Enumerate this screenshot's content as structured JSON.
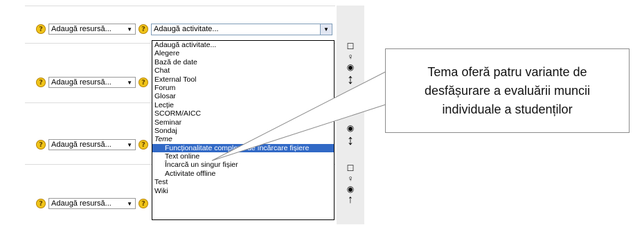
{
  "rows": [
    {
      "resource_label": "Adaugă resursă...",
      "activity_label": "Adaugă activitate..."
    },
    {
      "resource_label": "Adaugă resursă..."
    },
    {
      "resource_label": "Adaugă resursă..."
    },
    {
      "resource_label": "Adaugă resursă..."
    }
  ],
  "dropdown": {
    "options": [
      "Adaugă activitate...",
      "Alegere",
      "Bază de date",
      "Chat",
      "External Tool",
      "Forum",
      "Glosar",
      "Lecție",
      "SCORM/AICC",
      "Seminar",
      "Sondaj"
    ],
    "group_label": "Teme",
    "group_options": [
      "Funcționalitate complexă de încărcare fișiere",
      "Text online",
      "Încarcă un singur fișier",
      "Activitate offline"
    ],
    "trailing_options": [
      "Test",
      "Wiki"
    ],
    "selected": "Funcționalitate complexă de încărcare fișiere"
  },
  "callout": {
    "text": "Tema oferă patru variante de desfășurare a evaluării muncii individuale a studenților"
  },
  "colors": {
    "highlight": "#3169c6",
    "help_icon": "#f0c419"
  },
  "icons": [
    "help-icon",
    "checkbox-icon",
    "lightbulb-icon",
    "eye-icon",
    "move-icon",
    "up-arrow-icon"
  ]
}
